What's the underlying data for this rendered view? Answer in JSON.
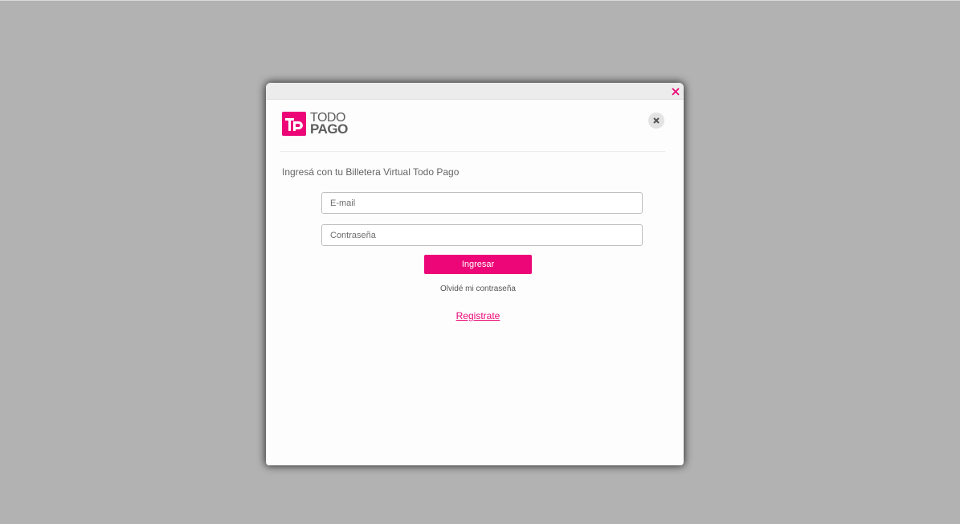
{
  "brand": {
    "line1": "TODO",
    "line2": "PAGO",
    "color": "#ec0677"
  },
  "icons": {
    "titlebar_close": "close-icon",
    "dialog_close": "close-icon",
    "logo": "todo-pago-logo"
  },
  "login": {
    "prompt": "Ingresá con tu Billetera Virtual Todo Pago",
    "email_placeholder": "E-mail",
    "password_placeholder": "Contraseña",
    "submit_label": "Ingresar",
    "forgot_label": "Olvidé mi contraseña",
    "register_label": "Registrate"
  }
}
